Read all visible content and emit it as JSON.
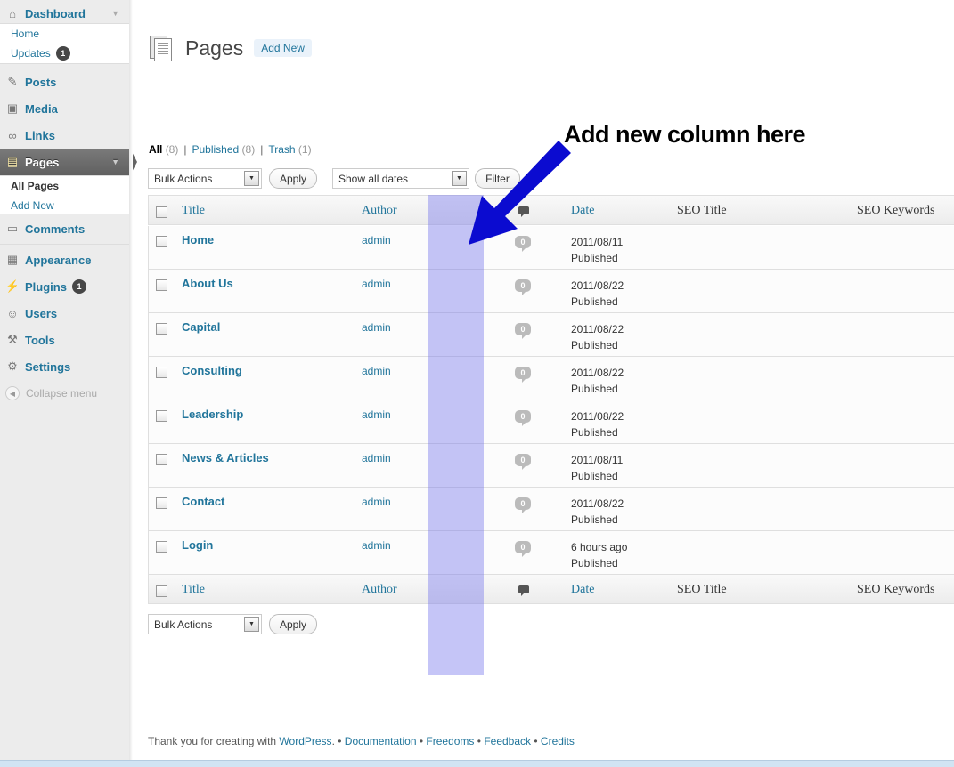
{
  "sidebar": {
    "dashboard": "Dashboard",
    "home": "Home",
    "updates": "Updates",
    "updates_badge": "1",
    "posts": "Posts",
    "media": "Media",
    "links": "Links",
    "pages": "Pages",
    "all_pages": "All Pages",
    "add_new": "Add New",
    "comments": "Comments",
    "appearance": "Appearance",
    "plugins": "Plugins",
    "plugins_badge": "1",
    "users": "Users",
    "tools": "Tools",
    "settings": "Settings",
    "collapse": "Collapse menu"
  },
  "header": {
    "title": "Pages",
    "add_new": "Add New"
  },
  "filters": {
    "all_label": "All",
    "all_count": "(8)",
    "published_label": "Published",
    "published_count": "(8)",
    "trash_label": "Trash",
    "trash_count": "(1)",
    "separator": "|"
  },
  "toolbar": {
    "bulk_actions": "Bulk Actions",
    "apply": "Apply",
    "dates": "Show all dates",
    "filter": "Filter"
  },
  "columns": {
    "title": "Title",
    "author": "Author",
    "date": "Date",
    "seo_title": "SEO Title",
    "seo_keywords": "SEO Keywords"
  },
  "rows": [
    {
      "title": "Home",
      "author": "admin",
      "comments": "0",
      "date": "2011/08/11",
      "status": "Published"
    },
    {
      "title": "About Us",
      "author": "admin",
      "comments": "0",
      "date": "2011/08/22",
      "status": "Published"
    },
    {
      "title": "Capital",
      "author": "admin",
      "comments": "0",
      "date": "2011/08/22",
      "status": "Published"
    },
    {
      "title": "Consulting",
      "author": "admin",
      "comments": "0",
      "date": "2011/08/22",
      "status": "Published"
    },
    {
      "title": "Leadership",
      "author": "admin",
      "comments": "0",
      "date": "2011/08/22",
      "status": "Published"
    },
    {
      "title": "News & Articles",
      "author": "admin",
      "comments": "0",
      "date": "2011/08/11",
      "status": "Published"
    },
    {
      "title": "Contact",
      "author": "admin",
      "comments": "0",
      "date": "2011/08/22",
      "status": "Published"
    },
    {
      "title": "Login",
      "author": "admin",
      "comments": "0",
      "date": "6 hours ago",
      "status": "Published"
    }
  ],
  "annotation": {
    "text": "Add new column here",
    "highlight_color": "#6e6eeb",
    "arrow_color": "#0b0bd0"
  },
  "footer": {
    "thanks": "Thank you for creating with",
    "wordpress": "WordPress",
    "dot": ".",
    "bullet": "•",
    "documentation": "Documentation",
    "freedoms": "Freedoms",
    "feedback": "Feedback",
    "credits": "Credits"
  },
  "colors": {
    "link": "#21759b",
    "sidebar_bg": "#ececec",
    "active_menu": "#6d6d6d"
  }
}
